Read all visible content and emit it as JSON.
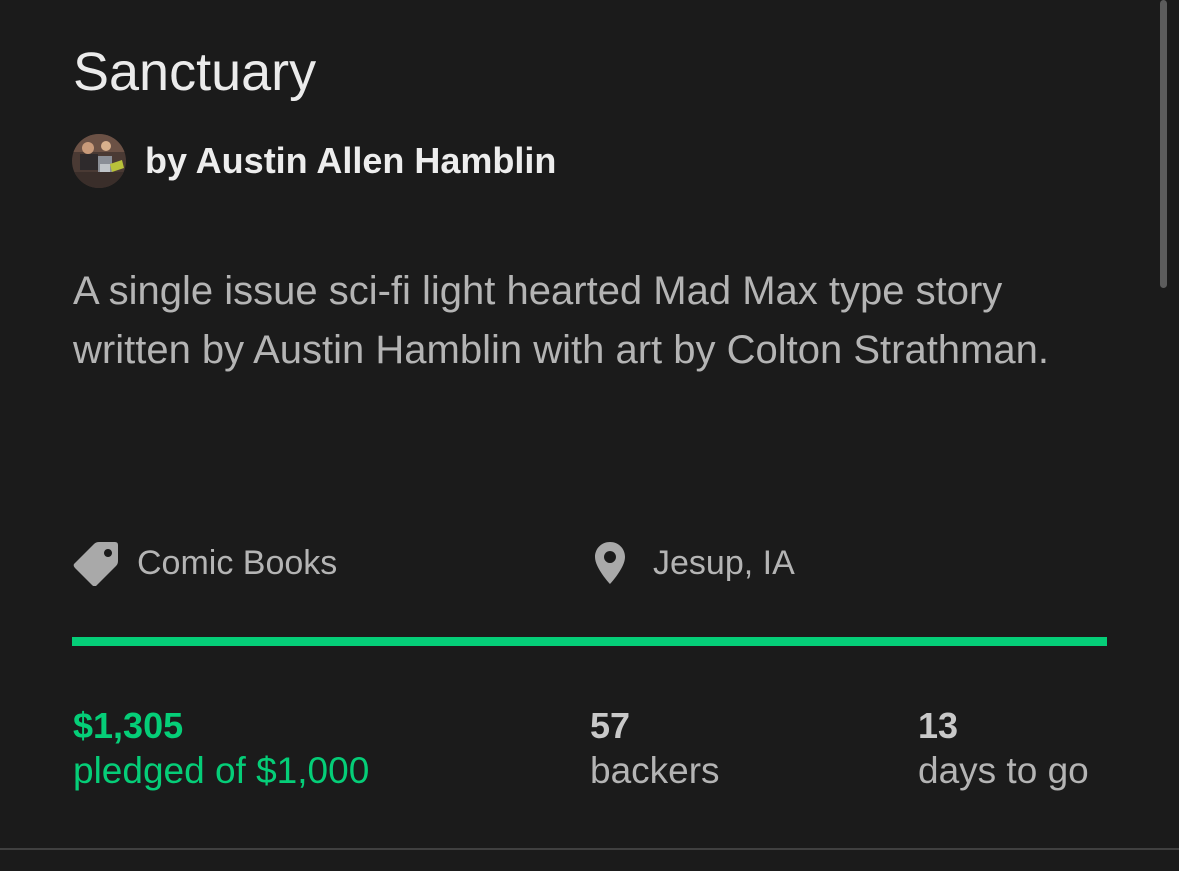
{
  "project": {
    "title": "Sanctuary",
    "creator_line": "by Austin Allen Hamblin",
    "blurb": "A single issue sci-fi light hearted Mad Max type story written by Austin Hamblin with art by Colton Strathman.",
    "category": {
      "label": "Comic Books",
      "icon": "tag-icon"
    },
    "location": {
      "label": "Jesup, IA",
      "icon": "location-pin-icon"
    }
  },
  "funding": {
    "progress_fraction": 1.0,
    "pledged_amount": "$1,305",
    "pledged_label": "pledged of $1,000",
    "backers_count": "57",
    "backers_label": "backers",
    "days_count": "13",
    "days_label": "days to go"
  },
  "colors": {
    "background": "#1b1b1b",
    "accent_green": "#05ce78",
    "primary_text": "#ebebeb",
    "secondary_text": "#b4b4b4"
  }
}
